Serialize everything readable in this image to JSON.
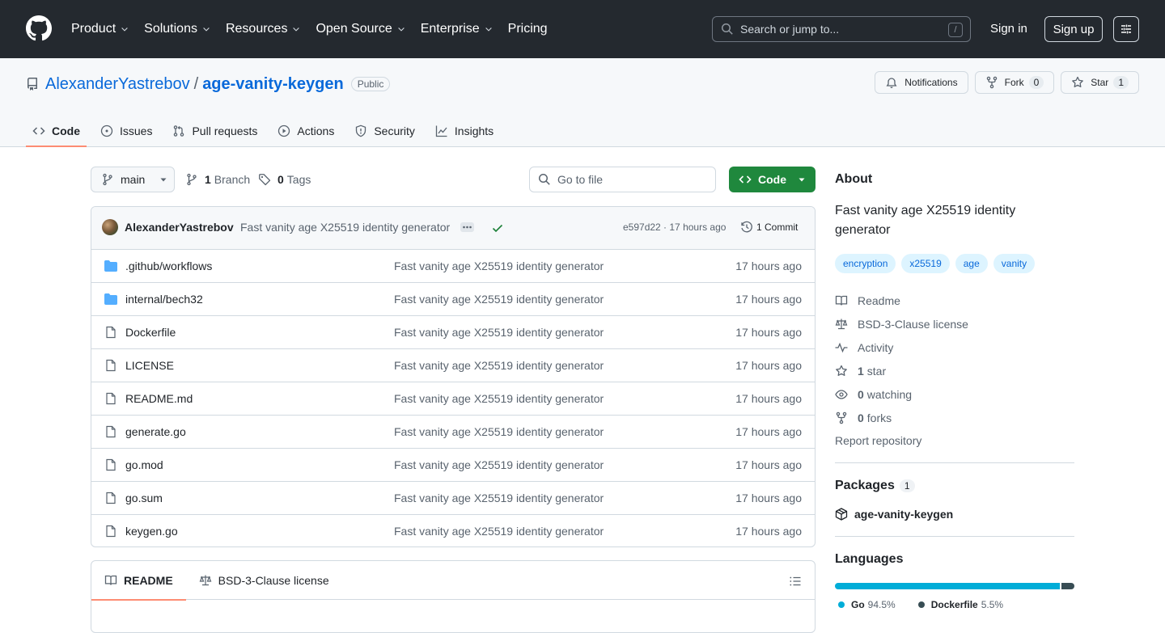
{
  "header": {
    "nav": [
      {
        "label": "Product",
        "has_menu": true
      },
      {
        "label": "Solutions",
        "has_menu": true
      },
      {
        "label": "Resources",
        "has_menu": true
      },
      {
        "label": "Open Source",
        "has_menu": true
      },
      {
        "label": "Enterprise",
        "has_menu": true
      },
      {
        "label": "Pricing",
        "has_menu": false
      }
    ],
    "search_placeholder": "Search or jump to...",
    "search_shortcut": "/",
    "signin": "Sign in",
    "signup": "Sign up"
  },
  "repo": {
    "owner": "AlexanderYastrebov",
    "separator": "/",
    "name": "age-vanity-keygen",
    "visibility": "Public",
    "actions": {
      "notifications": "Notifications",
      "fork_label": "Fork",
      "fork_count": "0",
      "star_label": "Star",
      "star_count": "1"
    },
    "tabs": [
      {
        "label": "Code",
        "icon": "code-icon",
        "active": true
      },
      {
        "label": "Issues",
        "icon": "issue-icon",
        "active": false
      },
      {
        "label": "Pull requests",
        "icon": "pull-request-icon",
        "active": false
      },
      {
        "label": "Actions",
        "icon": "play-icon",
        "active": false
      },
      {
        "label": "Security",
        "icon": "shield-icon",
        "active": false
      },
      {
        "label": "Insights",
        "icon": "graph-icon",
        "active": false
      }
    ]
  },
  "toolbar": {
    "branch": "main",
    "branches_count": "1",
    "branches_label": "Branch",
    "tags_count": "0",
    "tags_label": "Tags",
    "goto_placeholder": "Go to file",
    "code_button": "Code"
  },
  "commit": {
    "author": "AlexanderYastrebov",
    "message": "Fast vanity age X25519 identity generator",
    "sha_time": "e597d22 · 17 hours ago",
    "count_label": "1 Commit"
  },
  "files": [
    {
      "name": ".github/workflows",
      "type": "dir",
      "message": "Fast vanity age X25519 identity generator",
      "age": "17 hours ago"
    },
    {
      "name": "internal/bech32",
      "type": "dir",
      "message": "Fast vanity age X25519 identity generator",
      "age": "17 hours ago"
    },
    {
      "name": "Dockerfile",
      "type": "file",
      "message": "Fast vanity age X25519 identity generator",
      "age": "17 hours ago"
    },
    {
      "name": "LICENSE",
      "type": "file",
      "message": "Fast vanity age X25519 identity generator",
      "age": "17 hours ago"
    },
    {
      "name": "README.md",
      "type": "file",
      "message": "Fast vanity age X25519 identity generator",
      "age": "17 hours ago"
    },
    {
      "name": "generate.go",
      "type": "file",
      "message": "Fast vanity age X25519 identity generator",
      "age": "17 hours ago"
    },
    {
      "name": "go.mod",
      "type": "file",
      "message": "Fast vanity age X25519 identity generator",
      "age": "17 hours ago"
    },
    {
      "name": "go.sum",
      "type": "file",
      "message": "Fast vanity age X25519 identity generator",
      "age": "17 hours ago"
    },
    {
      "name": "keygen.go",
      "type": "file",
      "message": "Fast vanity age X25519 identity generator",
      "age": "17 hours ago"
    }
  ],
  "readme": {
    "tab_readme": "README",
    "tab_license": "BSD-3-Clause license"
  },
  "about": {
    "heading": "About",
    "description": "Fast vanity age X25519 identity generator",
    "topics": [
      "encryption",
      "x25519",
      "age",
      "vanity"
    ],
    "readme": "Readme",
    "license": "BSD-3-Clause license",
    "activity": "Activity",
    "stars_count": "1",
    "stars_label": "star",
    "watching_count": "0",
    "watching_label": "watching",
    "forks_count": "0",
    "forks_label": "forks",
    "report": "Report repository"
  },
  "packages": {
    "heading": "Packages",
    "count": "1",
    "items": [
      "age-vanity-keygen"
    ]
  },
  "languages": {
    "heading": "Languages",
    "items": [
      {
        "name": "Go",
        "percent": "94.5%",
        "share": 94.5,
        "color": "#00ADD8"
      },
      {
        "name": "Dockerfile",
        "percent": "5.5%",
        "share": 5.5,
        "color": "#384d54"
      }
    ]
  },
  "colors": {
    "header_bg": "#24292f",
    "link": "#0969da",
    "primary_button": "#1f883d",
    "active_tab_underline": "#fd8c73",
    "folder": "#54aeff"
  }
}
